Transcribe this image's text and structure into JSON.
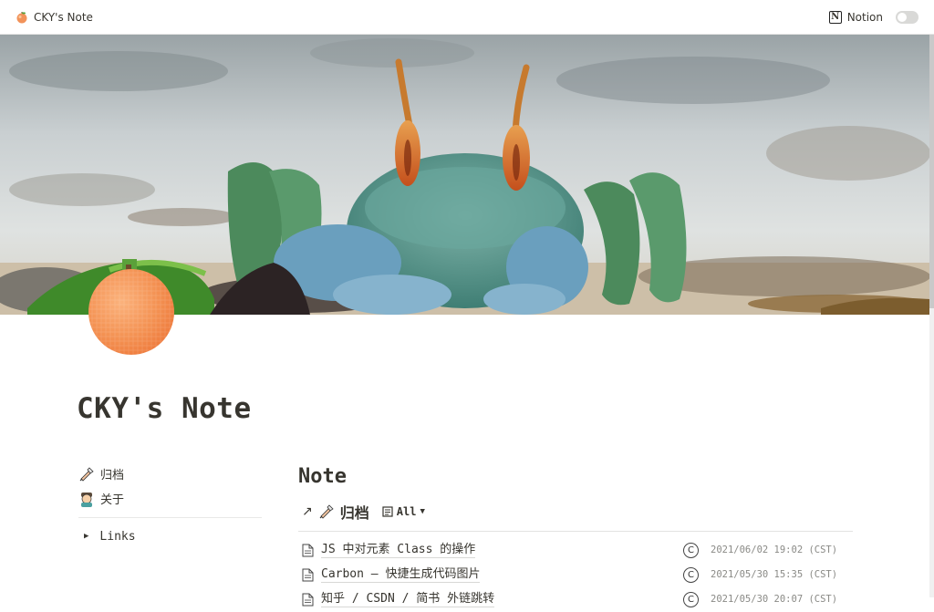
{
  "topbar": {
    "site_title": "CKY's Note",
    "notion_label": "Notion",
    "theme_toggle": "off"
  },
  "page": {
    "title": "CKY's Note"
  },
  "nav": {
    "items": [
      {
        "label": "归档",
        "icon": "quill-writing-icon"
      },
      {
        "label": "关于",
        "icon": "person-avatar-icon"
      }
    ],
    "toggle_label": "Links"
  },
  "main": {
    "section_title": "Note",
    "view": {
      "title": "归档",
      "selector_label": "All"
    },
    "rows": [
      {
        "name": "JS 中对元素 Class 的操作",
        "date": "2021/06/02 19:02 (CST)"
      },
      {
        "name": "Carbon – 快捷生成代码图片",
        "date": "2021/05/30 15:35 (CST)"
      },
      {
        "name": "知乎 / CSDN / 简书 外链跳转",
        "date": "2021/05/30 20:07 (CST)"
      }
    ]
  },
  "colors": {
    "text": "#37352f",
    "date_text": "#8a8a86",
    "divider": "#e3e3e1",
    "peach": "#f2935a"
  }
}
